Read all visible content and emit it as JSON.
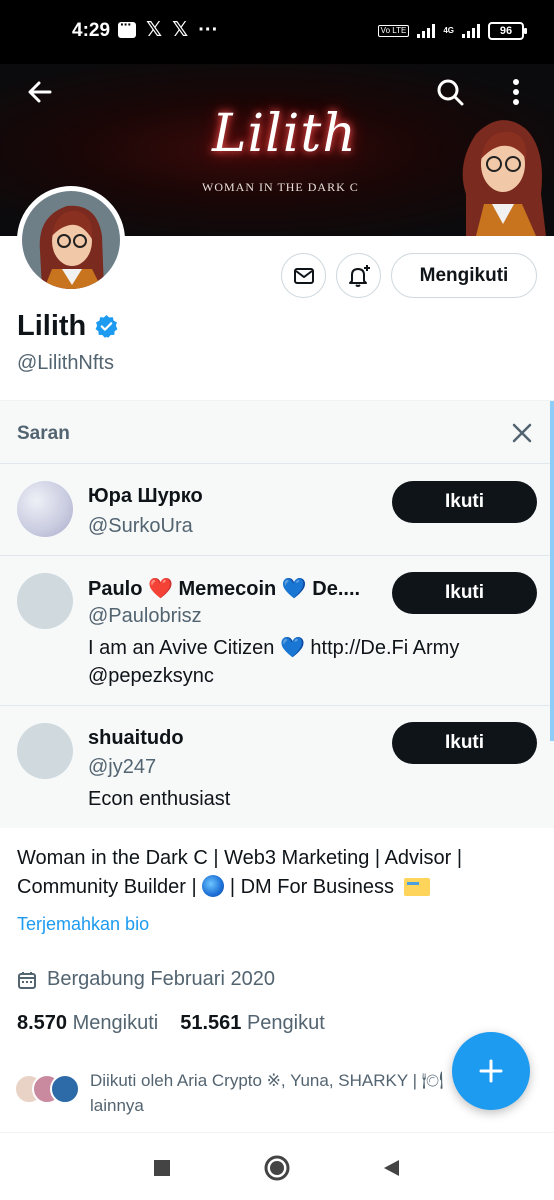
{
  "status_bar": {
    "time": "4:29",
    "left_icons": [
      "message-icon",
      "x-icon",
      "x-icon",
      "more-dots-icon"
    ],
    "volte": "Vo LTE",
    "network": "4G",
    "battery": "96"
  },
  "banner": {
    "title": "Lilith",
    "subtitle": "WOMAN IN THE DARK Ϲ"
  },
  "header_actions": {
    "back_icon": "arrow-left-icon",
    "search_icon": "search-icon",
    "more_icon": "more-vertical-icon"
  },
  "profile": {
    "display_name": "Lilith",
    "handle": "@LilithNfts",
    "following_button": "Mengikuti",
    "verified": true
  },
  "suggestions": {
    "heading": "Saran",
    "items": [
      {
        "name": "Юра Шурко",
        "handle": "@SurkoUra",
        "bio": "",
        "button": "Ikuti"
      },
      {
        "name": "Paulo ❤️ Memecoin 💙 De....",
        "handle": "@Paulobrisz",
        "bio": "I am an Avive Citizen 💙 http://De.Fi Army @pepezksync",
        "button": "Ikuti"
      },
      {
        "name": "shuaitudo",
        "handle": "@jy247",
        "bio": "Econ enthusiast",
        "button": "Ikuti"
      }
    ]
  },
  "bio": {
    "line1": "Woman in the Dark Ϲ | Web3 Marketing | Advisor |",
    "line2a": "Community Builder |",
    "line2b": "| DM For Business",
    "translate": "Terjemahkan bio",
    "joined": "Bergabung Februari 2020"
  },
  "stats": {
    "following_count": "8.570",
    "following_label": "Mengikuti",
    "followers_count": "51.561",
    "followers_label": "Pengikut"
  },
  "followed_by": {
    "text": "Diikuti oleh Aria Crypto ※, Yuna, SHARKY | 🍽 lainnya"
  },
  "colors": {
    "accent": "#1d9bf0",
    "text": "#0f1419",
    "secondary": "#536471",
    "button_dark": "#0f1419"
  }
}
